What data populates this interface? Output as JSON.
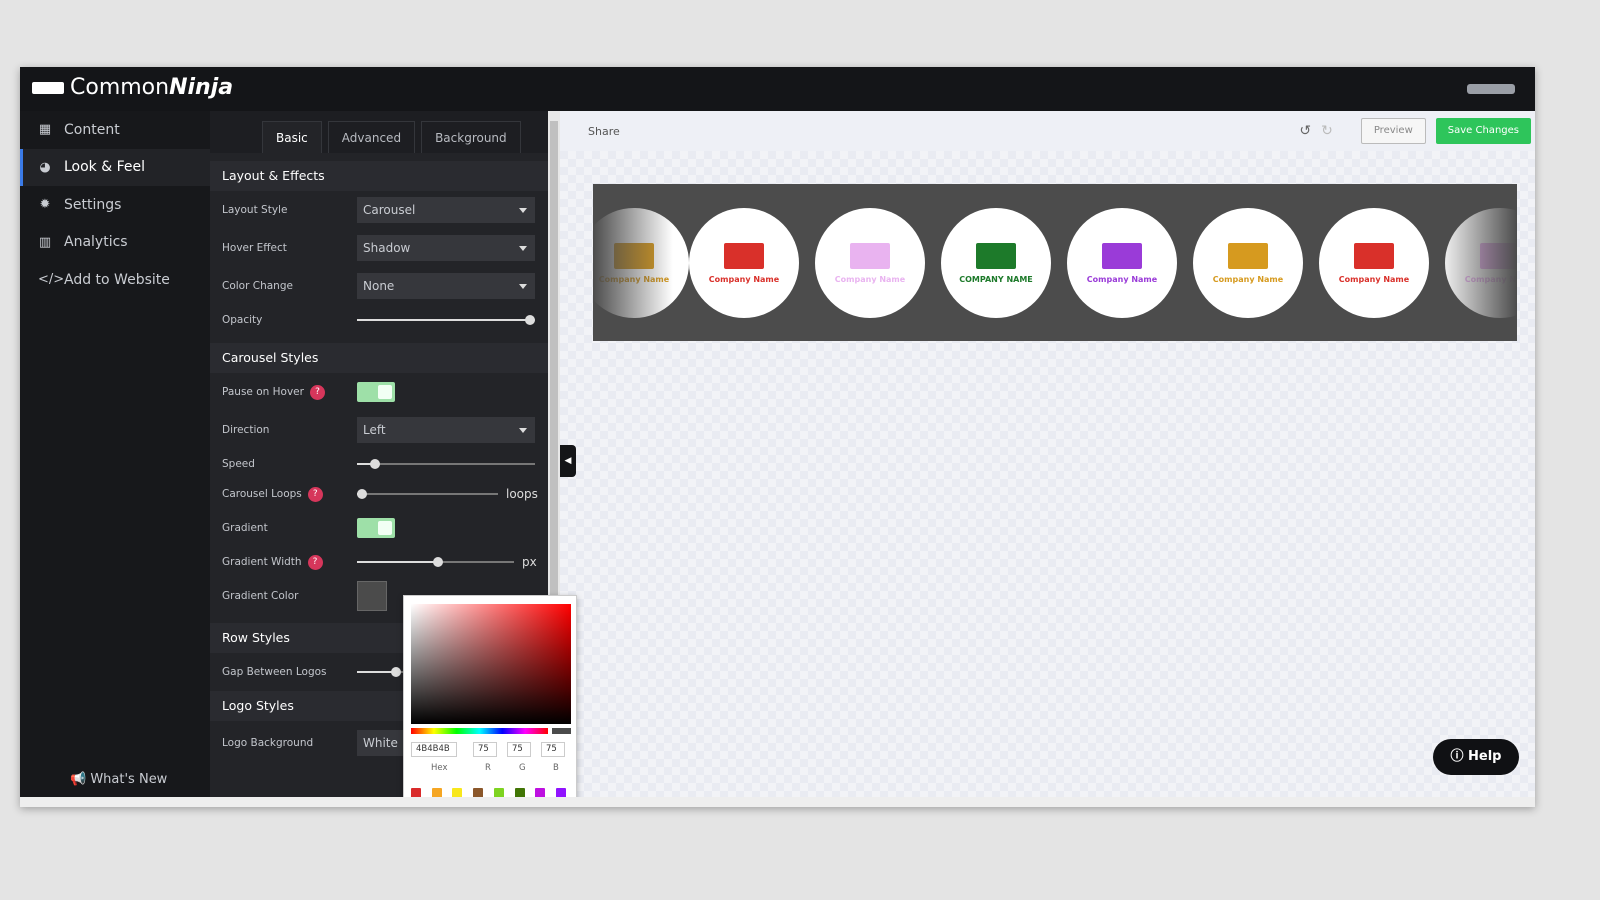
{
  "app": {
    "logo_light": "Common",
    "logo_bold": "Ninja"
  },
  "sidebar": {
    "items": [
      {
        "label": "Content",
        "icon": "table-icon"
      },
      {
        "label": "Look & Feel",
        "icon": "palette-icon"
      },
      {
        "label": "Settings",
        "icon": "gear-icon"
      },
      {
        "label": "Analytics",
        "icon": "chart-icon"
      },
      {
        "label": "Add to Website",
        "icon": "code-icon"
      }
    ],
    "active": "Look & Feel",
    "whats_new": "What's New"
  },
  "tabs": [
    "Basic",
    "Advanced",
    "Background"
  ],
  "panel": {
    "layout_section": "Layout & Effects",
    "layout_style": {
      "label": "Layout Style",
      "value": "Carousel"
    },
    "hover_effect": {
      "label": "Hover Effect",
      "value": "Shadow"
    },
    "color_change": {
      "label": "Color Change",
      "value": "None"
    },
    "opacity": {
      "label": "Opacity",
      "value_percent": 100
    },
    "carousel_section": "Carousel Styles",
    "pause_on_hover": {
      "label": "Pause on Hover",
      "on": true
    },
    "direction": {
      "label": "Direction",
      "value": "Left"
    },
    "speed": {
      "label": "Speed",
      "value_percent": 8
    },
    "carousel_loops": {
      "label": "Carousel Loops",
      "unit": "loops",
      "value_percent": 0
    },
    "gradient": {
      "label": "Gradient",
      "on": true
    },
    "gradient_width": {
      "label": "Gradient Width",
      "unit": "px",
      "value_percent": 52
    },
    "gradient_color": {
      "label": "Gradient Color",
      "color": "#4B4B4B"
    },
    "row_section": "Row Styles",
    "gap": {
      "label": "Gap Between Logos",
      "value_percent": 20
    },
    "logo_section": "Logo Styles",
    "logo_bg": {
      "label": "Logo Background",
      "value": "White"
    },
    "help_mark": "?"
  },
  "picker": {
    "hex": "4B4B4B",
    "r": "75",
    "g": "75",
    "b": "75",
    "hex_label": "Hex",
    "r_label": "R",
    "g_label": "G",
    "b_label": "B",
    "swatches": [
      "#d92b2b",
      "#f5a623",
      "#f8e71c",
      "#8b572a",
      "#7ed321",
      "#417505",
      "#bd10e0",
      "#9013fe"
    ]
  },
  "toolbar": {
    "share": "Share",
    "preview": "Preview",
    "save": "Save Changes"
  },
  "carousel": {
    "logos": [
      {
        "text": "Company Name",
        "color": "#d9302a"
      },
      {
        "text": "Company Name",
        "color": "#e9b3f0"
      },
      {
        "text": "COMPANY NAME",
        "color": "#1d7a2a"
      },
      {
        "text": "Company Name",
        "color": "#9a3bd8"
      },
      {
        "text": "Company Name",
        "color": "#d69a1f"
      },
      {
        "text": "Company Name",
        "color": "#d9302a"
      }
    ]
  },
  "help": "Help"
}
